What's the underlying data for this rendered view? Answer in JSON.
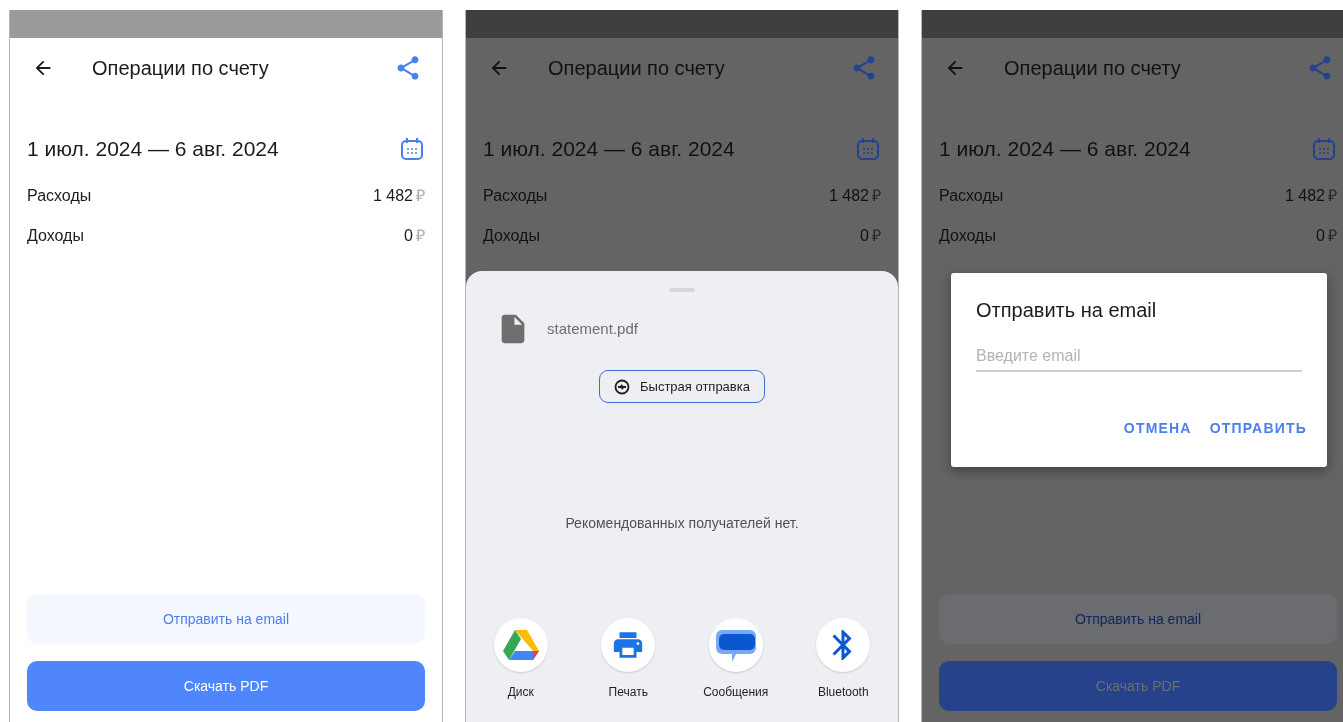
{
  "screens": [
    {
      "dimmed": false,
      "header": {
        "title": "Операции по счету"
      },
      "period": "1 июл. 2024 — 6 авг. 2024",
      "rows": [
        {
          "label": "Расходы",
          "amount": "1 482",
          "currency": "₽"
        },
        {
          "label": "Доходы",
          "amount": "0",
          "currency": "₽"
        }
      ],
      "buttons": [
        {
          "kind": "secondary",
          "label": "Отправить на email"
        },
        {
          "kind": "primary",
          "label": "Скачать PDF"
        }
      ]
    },
    {
      "dimmed": true,
      "header": {
        "title": "Операции по счету"
      },
      "period": "1 июл. 2024 — 6 авг. 2024",
      "rows": [
        {
          "label": "Расходы",
          "amount": "1 482",
          "currency": "₽"
        },
        {
          "label": "Доходы",
          "amount": "0",
          "currency": "₽"
        }
      ],
      "overlay": {
        "kind": "share_sheet",
        "file": "statement.pdf",
        "quick_share": "Быстрая отправка",
        "empty_text": "Рекомендованных получателей нет.",
        "apps": [
          {
            "kind": "drive",
            "label": "Диск"
          },
          {
            "kind": "print",
            "label": "Печать"
          },
          {
            "kind": "messages",
            "label": "Сообщения"
          },
          {
            "kind": "bluetooth",
            "label": "Bluetooth"
          }
        ]
      }
    },
    {
      "dimmed": true,
      "header": {
        "title": "Операции по счету"
      },
      "period": "1 июл. 2024 — 6 авг. 2024",
      "rows": [
        {
          "label": "Расходы",
          "amount": "1 482",
          "currency": "₽"
        },
        {
          "label": "Доходы",
          "amount": "0",
          "currency": "₽"
        }
      ],
      "buttons": [
        {
          "kind": "secondary",
          "label": "Отправить на email"
        },
        {
          "kind": "primary",
          "label": "Скачать PDF"
        }
      ],
      "overlay": {
        "kind": "dialog",
        "title": "Отправить на email",
        "input": {
          "placeholder": "Введите email"
        },
        "actions": [
          "ОТМЕНА",
          "ОТПРАВИТЬ"
        ]
      }
    }
  ]
}
